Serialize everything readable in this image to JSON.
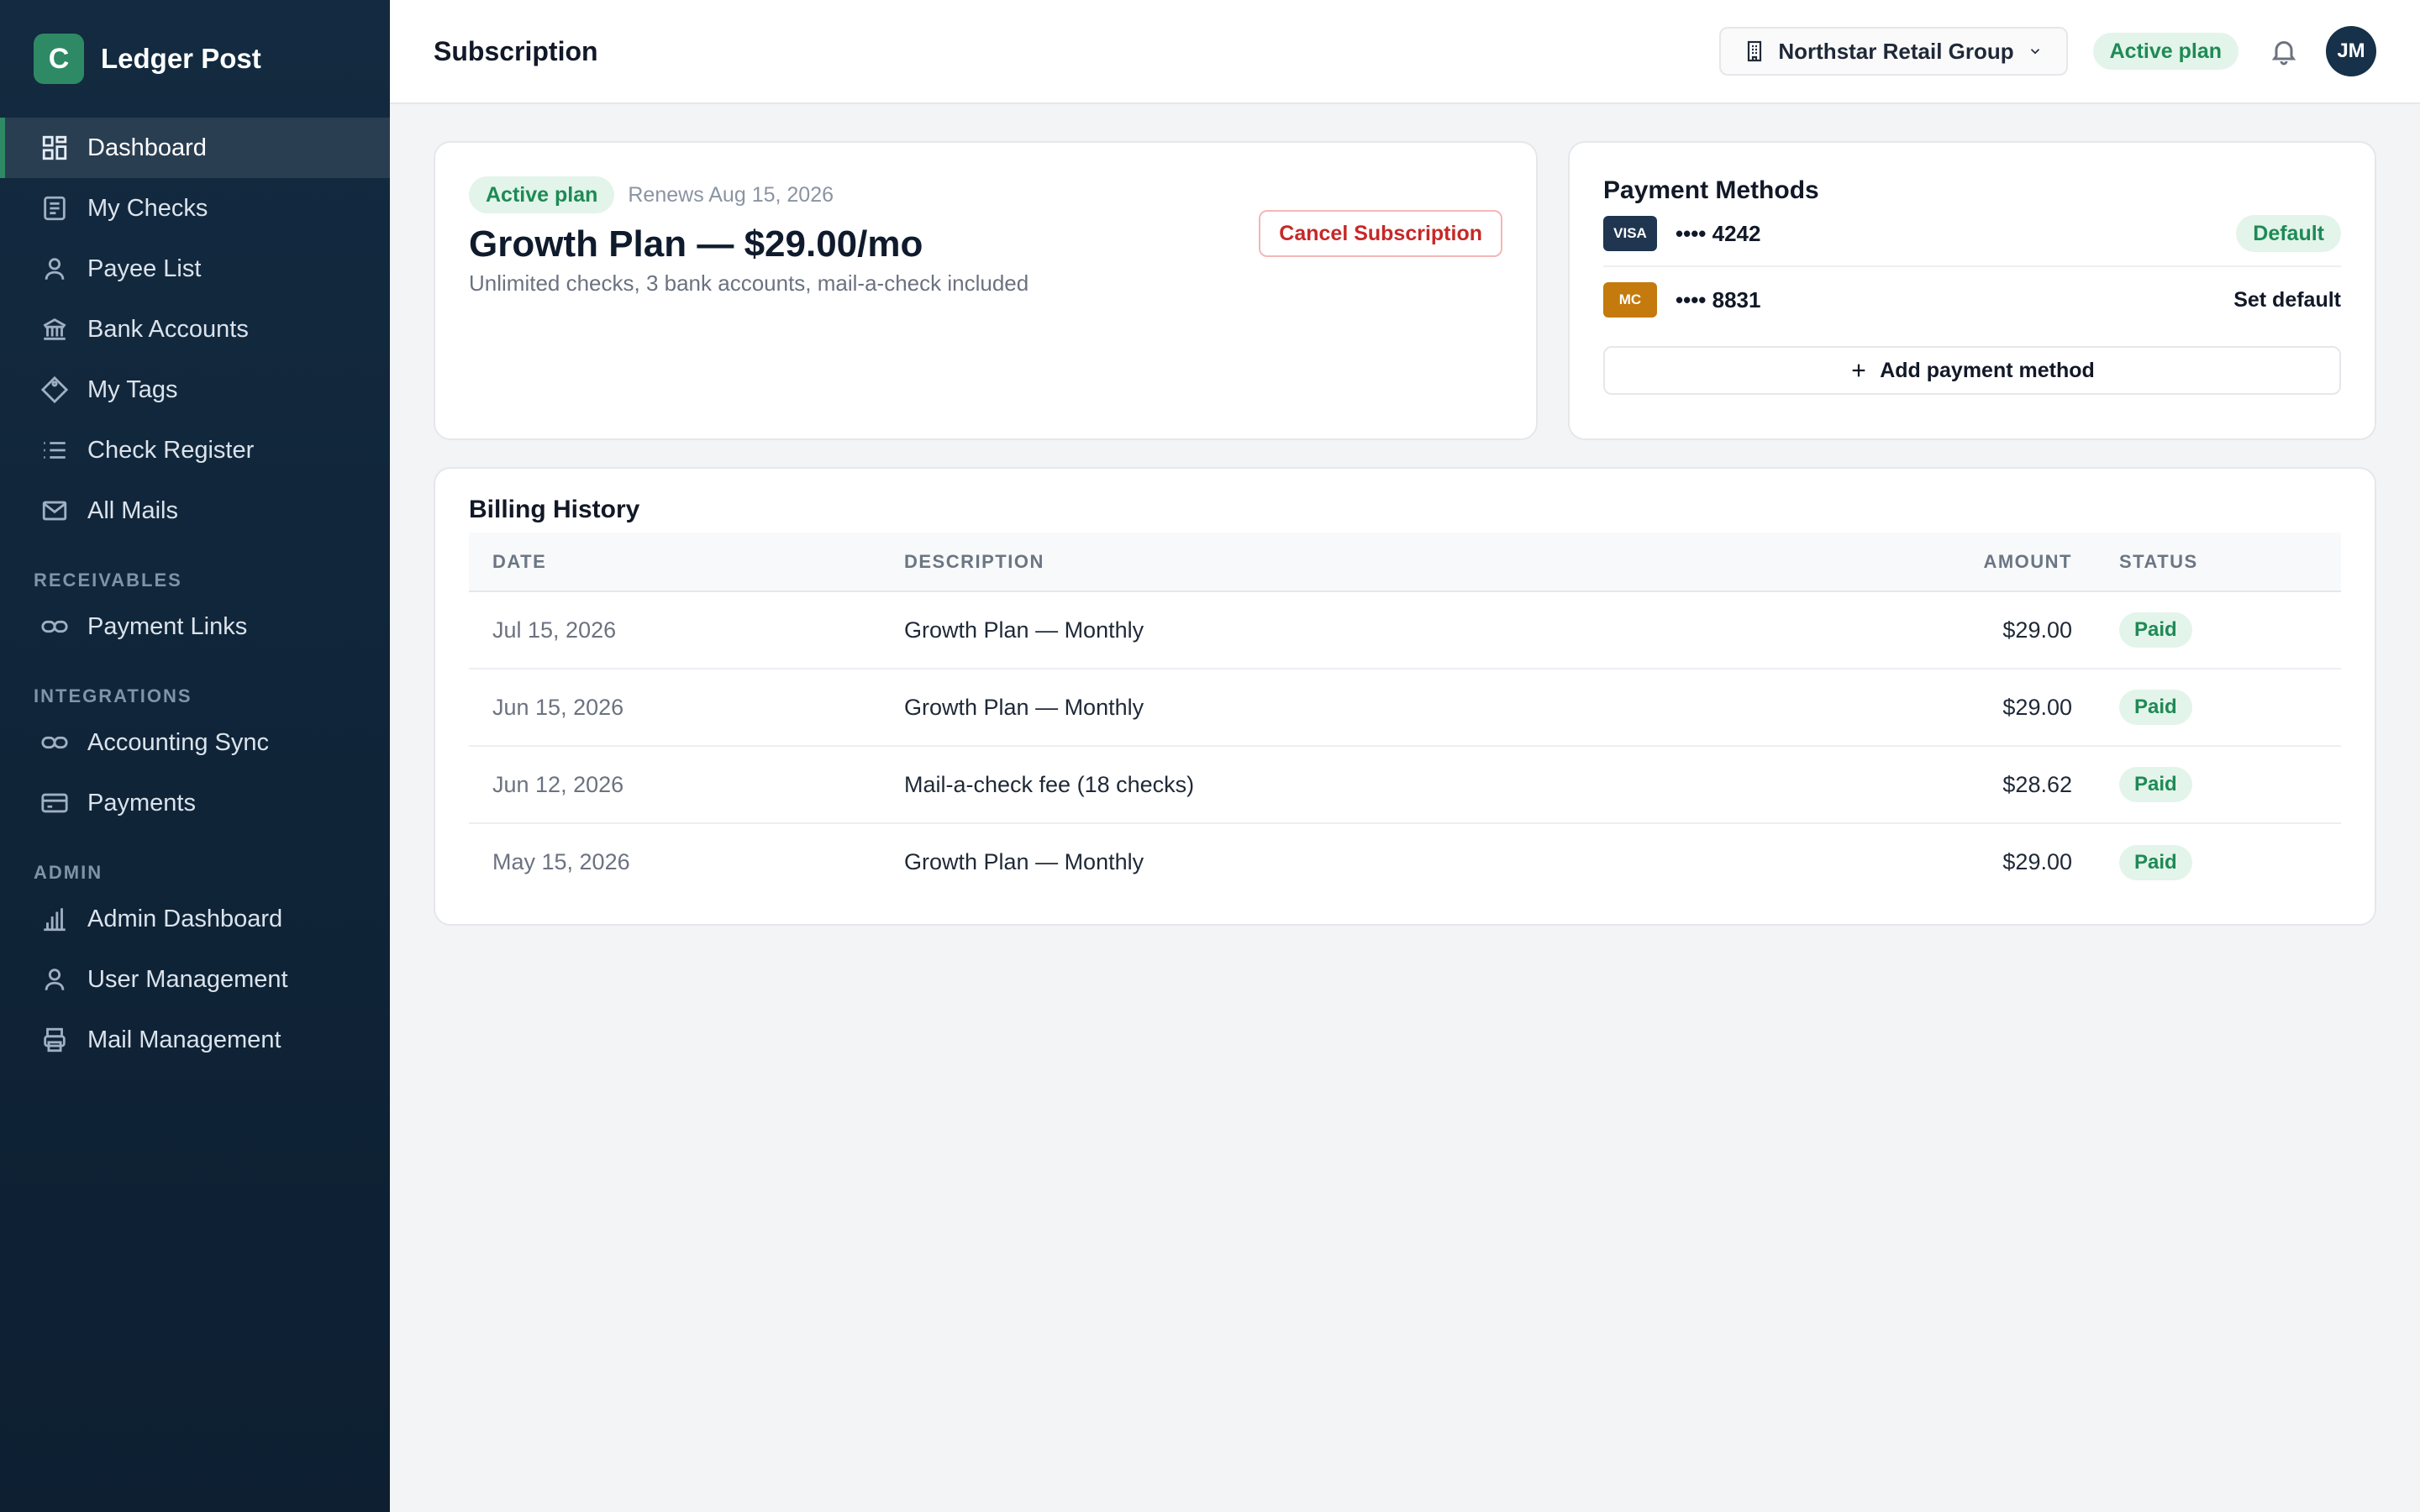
{
  "brand": {
    "logo_letter": "C",
    "name": "Ledger Post",
    "accent": "#2e8a64"
  },
  "sidebar": {
    "items": [
      {
        "label": "Dashboard",
        "icon": "dashboard-icon",
        "active": true
      },
      {
        "label": "My Checks",
        "icon": "document-icon"
      },
      {
        "label": "Payee List",
        "icon": "user-icon"
      },
      {
        "label": "Bank Accounts",
        "icon": "bank-icon"
      },
      {
        "label": "My Tags",
        "icon": "tag-icon"
      },
      {
        "label": "Check Register",
        "icon": "list-icon"
      },
      {
        "label": "All Mails",
        "icon": "mail-icon"
      }
    ],
    "receivables": {
      "title": "RECEIVABLES",
      "items": [
        {
          "label": "Payment Links",
          "icon": "link-icon"
        }
      ]
    },
    "integrations": {
      "title": "INTEGRATIONS",
      "items": [
        {
          "label": "Accounting Sync",
          "icon": "link-icon"
        },
        {
          "label": "Payments",
          "icon": "credit-card-icon"
        }
      ]
    },
    "admin": {
      "title": "ADMIN",
      "items": [
        {
          "label": "Admin Dashboard",
          "icon": "bar-chart-icon"
        },
        {
          "label": "User Management",
          "icon": "user-icon"
        },
        {
          "label": "Mail Management",
          "icon": "printer-icon"
        }
      ]
    }
  },
  "header": {
    "title": "Subscription",
    "org": "Northstar Retail Group",
    "plan_badge": "Active plan",
    "avatar_initials": "JM"
  },
  "plan": {
    "badge": "Active plan",
    "renews": "Renews Aug 15, 2026",
    "title": "Growth Plan — $29.00/mo",
    "description": "Unlimited checks, 3 bank accounts, mail-a-check included",
    "cancel_label": "Cancel Subscription"
  },
  "payment_methods": {
    "title": "Payment Methods",
    "cards": [
      {
        "brand": "VISA",
        "number": "•••• 4242",
        "color": "#1f3550",
        "status": "Default"
      },
      {
        "brand": "MC",
        "number": "•••• 8831",
        "color": "#c47a0c",
        "action": "Set default"
      }
    ],
    "add_label": "Add payment method"
  },
  "billing": {
    "title": "Billing History",
    "columns": [
      "DATE",
      "DESCRIPTION",
      "AMOUNT",
      "STATUS"
    ],
    "rows": [
      {
        "date": "Jul 15, 2026",
        "description": "Growth Plan — Monthly",
        "amount": "$29.00",
        "status": "Paid"
      },
      {
        "date": "Jun 15, 2026",
        "description": "Growth Plan — Monthly",
        "amount": "$29.00",
        "status": "Paid"
      },
      {
        "date": "Jun 12, 2026",
        "description": "Mail-a-check fee (18 checks)",
        "amount": "$28.62",
        "status": "Paid"
      },
      {
        "date": "May 15, 2026",
        "description": "Growth Plan — Monthly",
        "amount": "$29.00",
        "status": "Paid"
      }
    ]
  },
  "colors": {
    "sidebar_bg": "#132a40",
    "success": "#1e8a55",
    "danger": "#c62828"
  }
}
